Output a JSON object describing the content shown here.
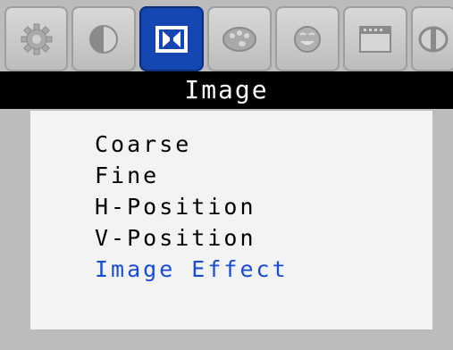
{
  "tabs": [
    {
      "icon": "gear-icon",
      "active": false
    },
    {
      "icon": "contrast-icon",
      "active": false
    },
    {
      "icon": "image-adjust-icon",
      "active": true
    },
    {
      "icon": "color-palette-icon",
      "active": false
    },
    {
      "icon": "face-icon",
      "active": false
    },
    {
      "icon": "window-icon",
      "active": false
    },
    {
      "icon": "info-icon",
      "active": false
    }
  ],
  "title": "Image",
  "menu": {
    "items": [
      {
        "label": "Coarse"
      },
      {
        "label": "Fine"
      },
      {
        "label": "H-Position"
      },
      {
        "label": "V-Position"
      },
      {
        "label": "Image Effect",
        "selected": true
      }
    ]
  },
  "colors": {
    "background": "#bcbcbc",
    "title_bar": "#000000",
    "panel": "#f2f3f5",
    "active_tab": "#1447b2",
    "selected_text": "#1a4bd6"
  }
}
